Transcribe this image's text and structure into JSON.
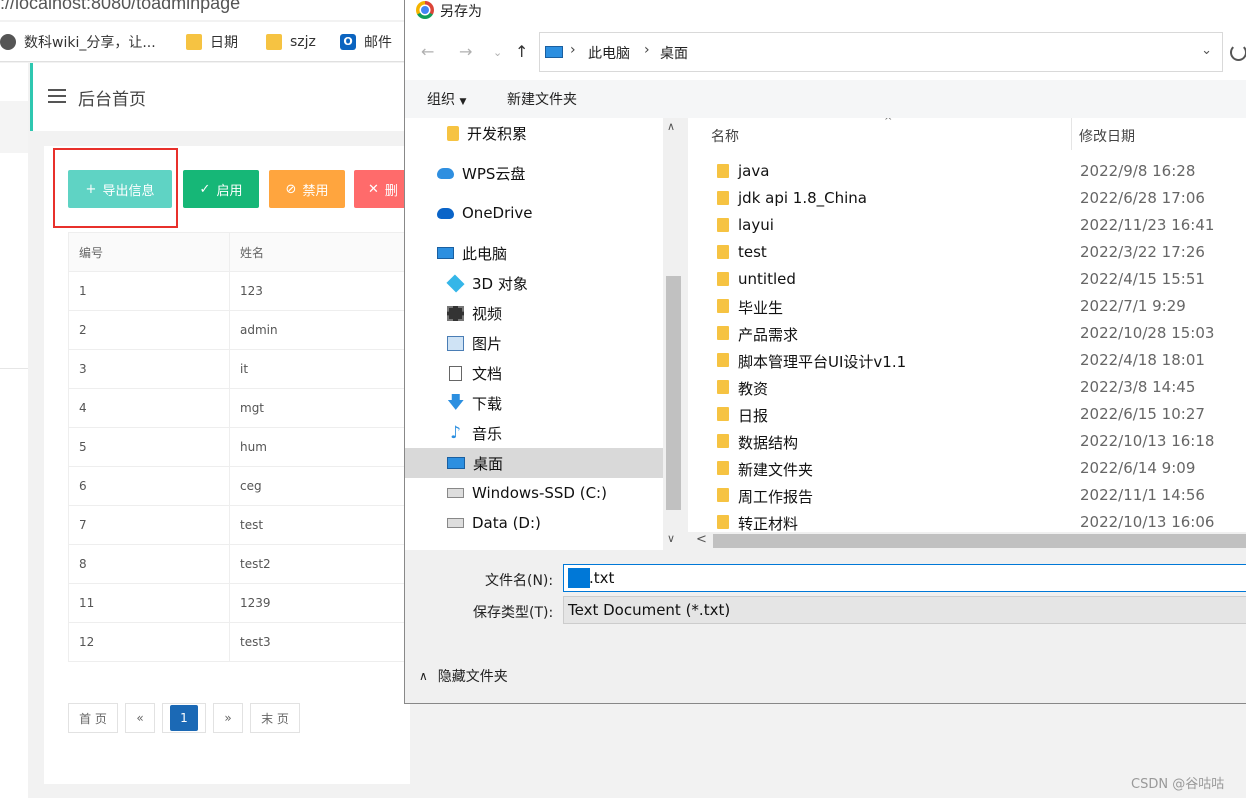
{
  "browser": {
    "url": "://localhost:8080/toadminpage",
    "bookmarks": [
      {
        "label": "数科wiki_分享，让...",
        "icon": "globe-icon"
      },
      {
        "label": "日期",
        "icon": "folder-icon"
      },
      {
        "label": "szjz",
        "icon": "folder-icon"
      },
      {
        "label": "邮件",
        "icon": "outlook-icon"
      }
    ]
  },
  "admin": {
    "page_title": "后台首页",
    "buttons": {
      "export": "导出信息",
      "enable": "启用",
      "disable": "禁用",
      "delete": "删"
    },
    "table": {
      "columns": [
        "编号",
        "姓名"
      ],
      "rows": [
        [
          "1",
          "123"
        ],
        [
          "2",
          "admin"
        ],
        [
          "3",
          "it"
        ],
        [
          "4",
          "mgt"
        ],
        [
          "5",
          "hum"
        ],
        [
          "6",
          "ceg"
        ],
        [
          "7",
          "test"
        ],
        [
          "8",
          "test2"
        ],
        [
          "11",
          "1239"
        ],
        [
          "12",
          "test3"
        ]
      ]
    },
    "pager": {
      "first": "首 页",
      "prev": "«",
      "current": "1",
      "next": "»",
      "last": "末 页"
    }
  },
  "dialog": {
    "title": "另存为",
    "breadcrumb": [
      "此电脑",
      "桌面"
    ],
    "toolbar": {
      "organize": "组织",
      "new_folder": "新建文件夹"
    },
    "tree": [
      {
        "label": "开发积累",
        "icon": "folder-icon"
      },
      {
        "label": "WPS云盘",
        "icon": "cloud-icon"
      },
      {
        "label": "OneDrive",
        "icon": "onedrive-icon"
      },
      {
        "label": "此电脑",
        "icon": "pc-icon"
      },
      {
        "label": "3D 对象",
        "icon": "3d-objects-icon"
      },
      {
        "label": "视频",
        "icon": "video-icon"
      },
      {
        "label": "图片",
        "icon": "pictures-icon"
      },
      {
        "label": "文档",
        "icon": "documents-icon"
      },
      {
        "label": "下载",
        "icon": "downloads-icon"
      },
      {
        "label": "音乐",
        "icon": "music-icon"
      },
      {
        "label": "桌面",
        "icon": "desktop-icon",
        "selected": true
      },
      {
        "label": "Windows-SSD (C:)",
        "icon": "drive-icon"
      },
      {
        "label": "Data (D:)",
        "icon": "drive-icon"
      }
    ],
    "columns": {
      "name": "名称",
      "modified": "修改日期"
    },
    "files": [
      {
        "name": "java",
        "date": "2022/9/8 16:28"
      },
      {
        "name": "jdk api 1.8_China",
        "date": "2022/6/28 17:06"
      },
      {
        "name": "layui",
        "date": "2022/11/23 16:41"
      },
      {
        "name": "test",
        "date": "2022/3/22 17:26"
      },
      {
        "name": "untitled",
        "date": "2022/4/15 15:51"
      },
      {
        "name": "毕业生",
        "date": "2022/7/1 9:29"
      },
      {
        "name": "产品需求",
        "date": "2022/10/28 15:03"
      },
      {
        "name": "脚本管理平台UI设计v1.1",
        "date": "2022/4/18 18:01"
      },
      {
        "name": "教资",
        "date": "2022/3/8 14:45"
      },
      {
        "name": "日报",
        "date": "2022/6/15 10:27"
      },
      {
        "name": "数据结构",
        "date": "2022/10/13 16:18"
      },
      {
        "name": "新建文件夹",
        "date": "2022/6/14 9:09"
      },
      {
        "name": "周工作报告",
        "date": "2022/11/1 14:56"
      },
      {
        "name": "转正材料",
        "date": "2022/10/13 16:06"
      }
    ],
    "filename_label": "文件名(N):",
    "filename_value": ".txt",
    "filetype_label": "保存类型(T):",
    "filetype_value": "Text Document (*.txt)",
    "hide_folders": "隐藏文件夹"
  },
  "watermark": "CSDN @谷咕咕"
}
